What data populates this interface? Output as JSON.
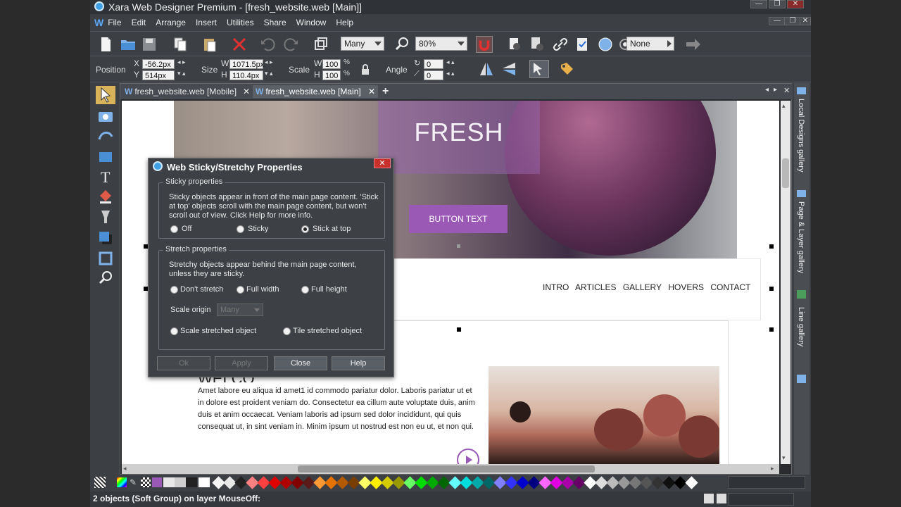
{
  "app": {
    "title": "Xara Web Designer Premium - [fresh_website.web [Main]]",
    "menu": [
      "File",
      "Edit",
      "Arrange",
      "Insert",
      "Utilities",
      "Share",
      "Window",
      "Help"
    ],
    "logo": "W"
  },
  "toolbar1": {
    "quality_combo": "Many",
    "zoom_combo": "80%",
    "none_combo": "None"
  },
  "toolbar2": {
    "position_label": "Position",
    "x_label": "X",
    "y_label": "Y",
    "x_value": "-56.2px",
    "y_value": "514px",
    "size_label": "Size",
    "w_label": "W",
    "h_label": "H",
    "w_value": "1071.5px",
    "h_value": "110.4px",
    "scale_label": "Scale",
    "scale_w_label": "W",
    "scale_h_label": "H",
    "scale_w": "100",
    "scale_h": "100",
    "percent": "%",
    "angle_label": "Angle",
    "angle_value": "0",
    "skew_value": "0"
  },
  "tabs": [
    {
      "label": "fresh_website.web [Mobile]"
    },
    {
      "label": "fresh_website.web [Main]"
    }
  ],
  "tab_add": "+",
  "rail": [
    "Local Designs gallery",
    "Page & Layer gallery",
    "Line gallery"
  ],
  "page": {
    "hero_title": "FRESH",
    "button_text": "BUTTON TEXT",
    "nav": [
      "INTRO",
      "ARTICLES",
      "GALLERY",
      "HOVERS",
      "CONTACT"
    ],
    "heading": "WELCOME",
    "lorem": "Amet labore eu aliqua id amet1 id commodo pariatur dolor. Laboris pariatur ut et in dolore est proident veniam do. Consectetur ea cillum aute voluptate duis, anim duis et anim occaecat. Veniam laboris ad ipsum sed dolor incididunt, qui quis consequat ut, in sint veniam in. Minim ipsum ut nostrud est non eu ut, et non qui."
  },
  "dialog": {
    "title": "Web Sticky/Stretchy Properties",
    "close": "✕",
    "sticky_title": "Sticky properties",
    "sticky_desc": "Sticky objects appear in front of the main page content. 'Stick at top' objects scroll with the main page content, but won't scroll out of view. Click Help for more info.",
    "sticky_options": [
      "Off",
      "Sticky",
      "Stick at top"
    ],
    "sticky_selected": "Stick at top",
    "stretch_title": "Stretch properties",
    "stretch_desc": "Stretchy objects appear behind the main page content, unless they are sticky.",
    "stretch_options": [
      "Don't stretch",
      "Full width",
      "Full height"
    ],
    "scale_origin_label": "Scale origin",
    "scale_origin_value": "Many",
    "stretch_mode_options": [
      "Scale stretched object",
      "Tile stretched object"
    ],
    "buttons": {
      "ok": "Ok",
      "apply": "Apply",
      "close": "Close",
      "help": "Help"
    }
  },
  "status": {
    "text": "2 objects (Soft Group) on layer MouseOff:"
  },
  "palette": [
    "#f5f5f5",
    "#e8e8e8",
    "#222222",
    "#ff8080",
    "#ff4040",
    "#e00000",
    "#b00000",
    "#800000",
    "#5a1a1a",
    "#ff9933",
    "#e67300",
    "#b35900",
    "#7a3d00",
    "#ffff66",
    "#ffee00",
    "#d4cc00",
    "#999900",
    "#66ff66",
    "#00dd00",
    "#00aa00",
    "#006600",
    "#66ffff",
    "#00dddd",
    "#00aaaa",
    "#006666",
    "#8080ff",
    "#3333ff",
    "#0000cc",
    "#000080",
    "#ff66ff",
    "#e000e0",
    "#aa00aa",
    "#660066",
    "#ffffff",
    "#dddddd",
    "#bbbbbb",
    "#999999",
    "#777777",
    "#555555",
    "#333333",
    "#111111",
    "#000000",
    "#ffffff"
  ],
  "colors": {
    "accent_purple": "#9b59b6",
    "window_bg": "#3c3f44"
  }
}
